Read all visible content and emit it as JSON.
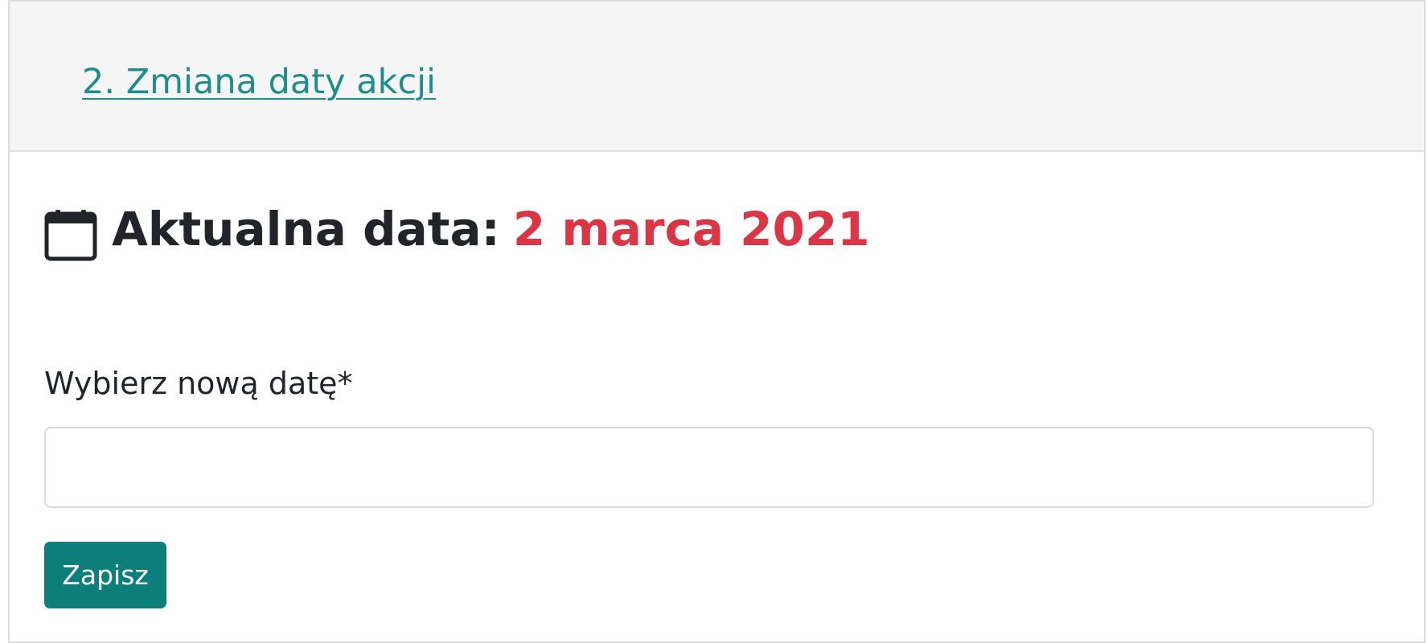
{
  "header": {
    "link_text": "2. Zmiana daty akcji"
  },
  "current_date": {
    "icon": "calendar-icon",
    "label": "Aktualna data:",
    "value": "2 marca 2021",
    "value_color": "#dc3545"
  },
  "form": {
    "label": "Wybierz nową datę*",
    "date_input_value": "",
    "date_input_placeholder": "",
    "save_label": "Zapisz",
    "save_color": "#0d7f7a",
    "link_color": "#1e8e8c"
  }
}
